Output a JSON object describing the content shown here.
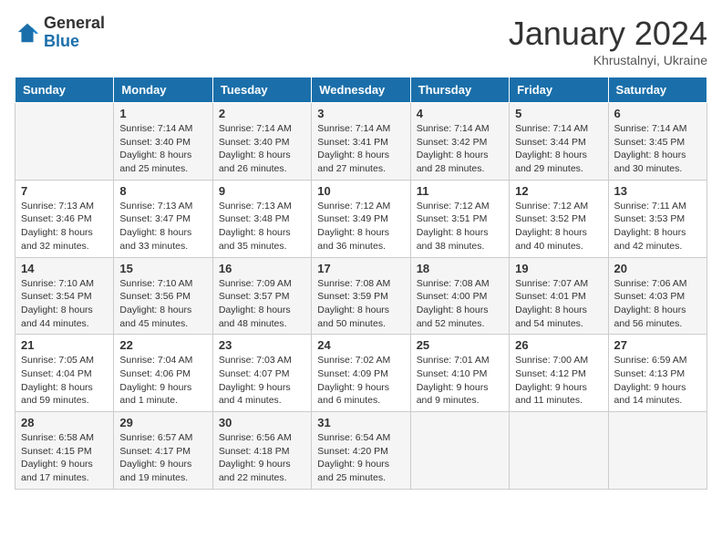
{
  "logo": {
    "general": "General",
    "blue": "Blue"
  },
  "header": {
    "month": "January 2024",
    "location": "Khrustalnyi, Ukraine"
  },
  "days_of_week": [
    "Sunday",
    "Monday",
    "Tuesday",
    "Wednesday",
    "Thursday",
    "Friday",
    "Saturday"
  ],
  "weeks": [
    [
      {
        "day": "",
        "sunrise": "",
        "sunset": "",
        "daylight": ""
      },
      {
        "day": "1",
        "sunrise": "7:14 AM",
        "sunset": "3:40 PM",
        "daylight": "8 hours and 25 minutes."
      },
      {
        "day": "2",
        "sunrise": "7:14 AM",
        "sunset": "3:40 PM",
        "daylight": "8 hours and 26 minutes."
      },
      {
        "day": "3",
        "sunrise": "7:14 AM",
        "sunset": "3:41 PM",
        "daylight": "8 hours and 27 minutes."
      },
      {
        "day": "4",
        "sunrise": "7:14 AM",
        "sunset": "3:42 PM",
        "daylight": "8 hours and 28 minutes."
      },
      {
        "day": "5",
        "sunrise": "7:14 AM",
        "sunset": "3:44 PM",
        "daylight": "8 hours and 29 minutes."
      },
      {
        "day": "6",
        "sunrise": "7:14 AM",
        "sunset": "3:45 PM",
        "daylight": "8 hours and 30 minutes."
      }
    ],
    [
      {
        "day": "7",
        "sunrise": "7:13 AM",
        "sunset": "3:46 PM",
        "daylight": "8 hours and 32 minutes."
      },
      {
        "day": "8",
        "sunrise": "7:13 AM",
        "sunset": "3:47 PM",
        "daylight": "8 hours and 33 minutes."
      },
      {
        "day": "9",
        "sunrise": "7:13 AM",
        "sunset": "3:48 PM",
        "daylight": "8 hours and 35 minutes."
      },
      {
        "day": "10",
        "sunrise": "7:12 AM",
        "sunset": "3:49 PM",
        "daylight": "8 hours and 36 minutes."
      },
      {
        "day": "11",
        "sunrise": "7:12 AM",
        "sunset": "3:51 PM",
        "daylight": "8 hours and 38 minutes."
      },
      {
        "day": "12",
        "sunrise": "7:12 AM",
        "sunset": "3:52 PM",
        "daylight": "8 hours and 40 minutes."
      },
      {
        "day": "13",
        "sunrise": "7:11 AM",
        "sunset": "3:53 PM",
        "daylight": "8 hours and 42 minutes."
      }
    ],
    [
      {
        "day": "14",
        "sunrise": "7:10 AM",
        "sunset": "3:54 PM",
        "daylight": "8 hours and 44 minutes."
      },
      {
        "day": "15",
        "sunrise": "7:10 AM",
        "sunset": "3:56 PM",
        "daylight": "8 hours and 45 minutes."
      },
      {
        "day": "16",
        "sunrise": "7:09 AM",
        "sunset": "3:57 PM",
        "daylight": "8 hours and 48 minutes."
      },
      {
        "day": "17",
        "sunrise": "7:08 AM",
        "sunset": "3:59 PM",
        "daylight": "8 hours and 50 minutes."
      },
      {
        "day": "18",
        "sunrise": "7:08 AM",
        "sunset": "4:00 PM",
        "daylight": "8 hours and 52 minutes."
      },
      {
        "day": "19",
        "sunrise": "7:07 AM",
        "sunset": "4:01 PM",
        "daylight": "8 hours and 54 minutes."
      },
      {
        "day": "20",
        "sunrise": "7:06 AM",
        "sunset": "4:03 PM",
        "daylight": "8 hours and 56 minutes."
      }
    ],
    [
      {
        "day": "21",
        "sunrise": "7:05 AM",
        "sunset": "4:04 PM",
        "daylight": "8 hours and 59 minutes."
      },
      {
        "day": "22",
        "sunrise": "7:04 AM",
        "sunset": "4:06 PM",
        "daylight": "9 hours and 1 minute."
      },
      {
        "day": "23",
        "sunrise": "7:03 AM",
        "sunset": "4:07 PM",
        "daylight": "9 hours and 4 minutes."
      },
      {
        "day": "24",
        "sunrise": "7:02 AM",
        "sunset": "4:09 PM",
        "daylight": "9 hours and 6 minutes."
      },
      {
        "day": "25",
        "sunrise": "7:01 AM",
        "sunset": "4:10 PM",
        "daylight": "9 hours and 9 minutes."
      },
      {
        "day": "26",
        "sunrise": "7:00 AM",
        "sunset": "4:12 PM",
        "daylight": "9 hours and 11 minutes."
      },
      {
        "day": "27",
        "sunrise": "6:59 AM",
        "sunset": "4:13 PM",
        "daylight": "9 hours and 14 minutes."
      }
    ],
    [
      {
        "day": "28",
        "sunrise": "6:58 AM",
        "sunset": "4:15 PM",
        "daylight": "9 hours and 17 minutes."
      },
      {
        "day": "29",
        "sunrise": "6:57 AM",
        "sunset": "4:17 PM",
        "daylight": "9 hours and 19 minutes."
      },
      {
        "day": "30",
        "sunrise": "6:56 AM",
        "sunset": "4:18 PM",
        "daylight": "9 hours and 22 minutes."
      },
      {
        "day": "31",
        "sunrise": "6:54 AM",
        "sunset": "4:20 PM",
        "daylight": "9 hours and 25 minutes."
      },
      {
        "day": "",
        "sunrise": "",
        "sunset": "",
        "daylight": ""
      },
      {
        "day": "",
        "sunrise": "",
        "sunset": "",
        "daylight": ""
      },
      {
        "day": "",
        "sunrise": "",
        "sunset": "",
        "daylight": ""
      }
    ]
  ]
}
